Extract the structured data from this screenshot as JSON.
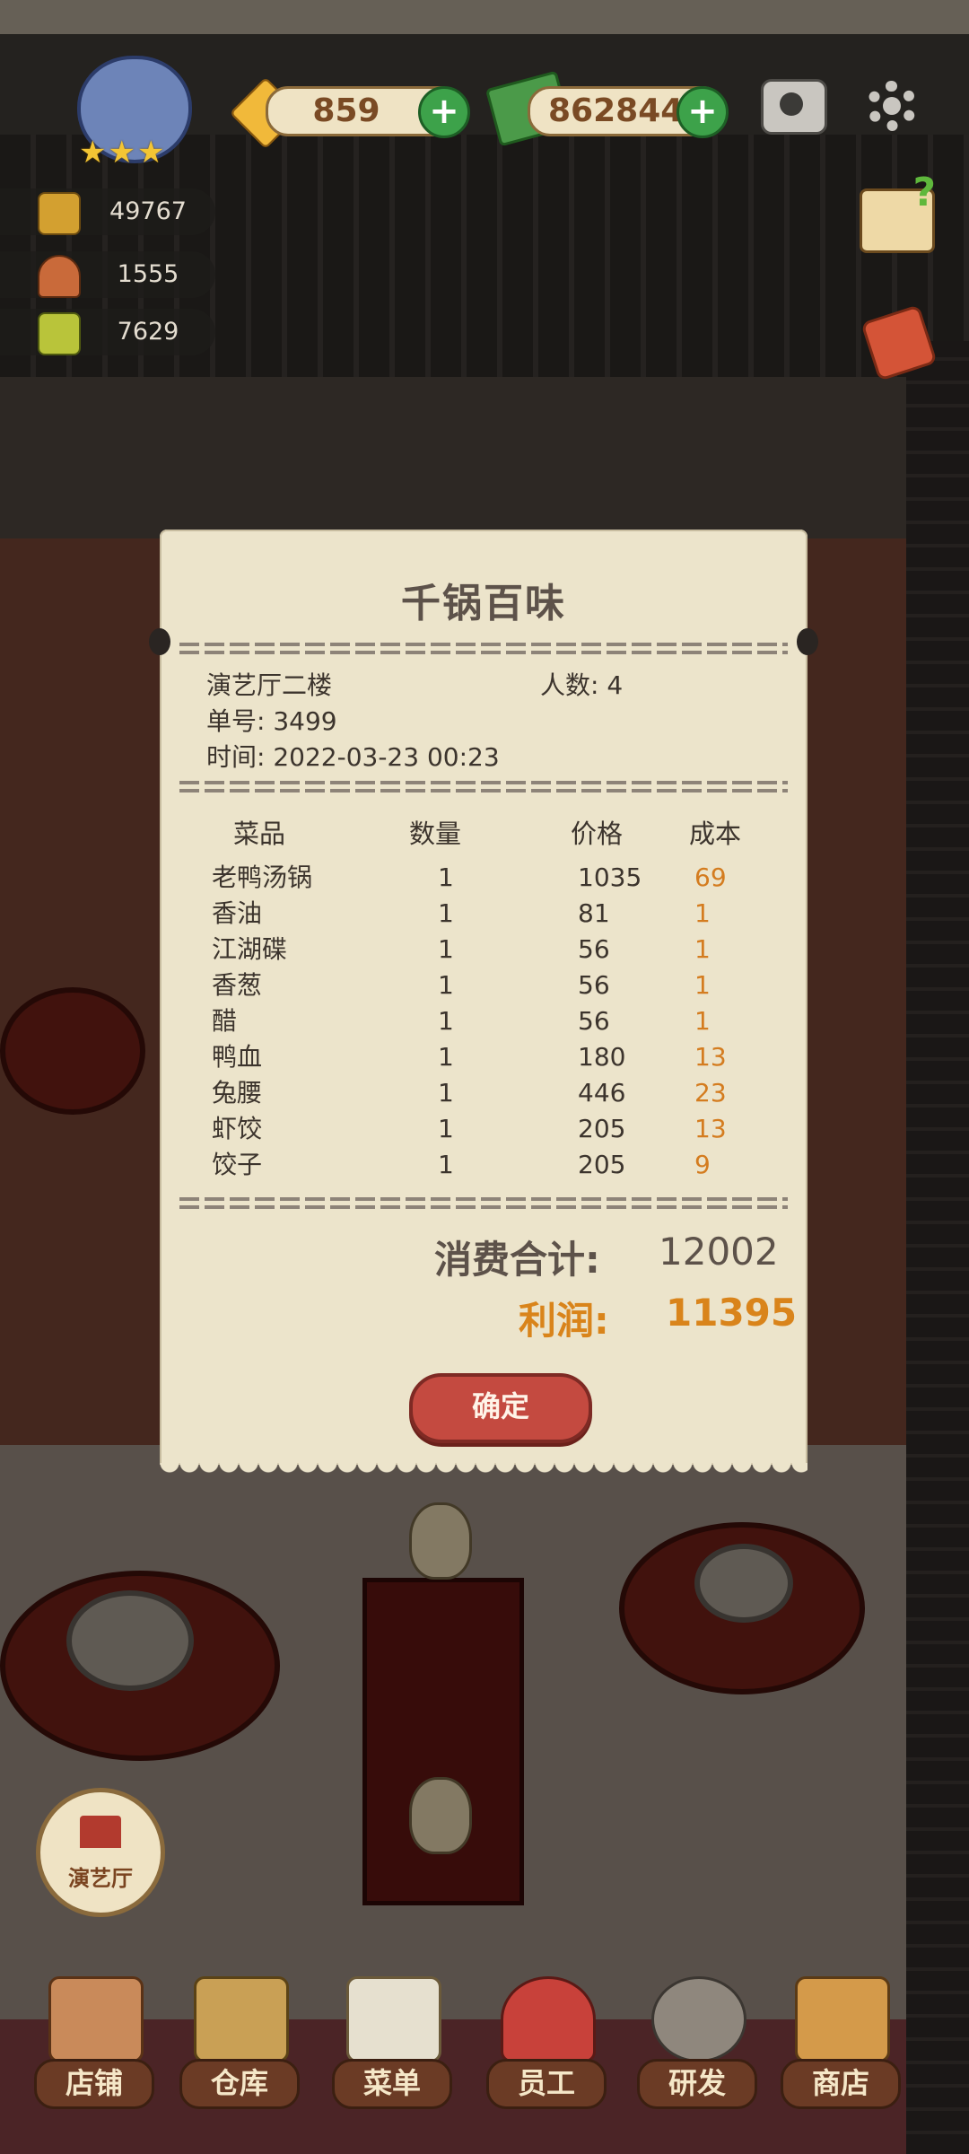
{
  "hud": {
    "gems": "859",
    "cash": "862844",
    "resources": [
      {
        "icon": "gold-pot-icon",
        "value": "49767"
      },
      {
        "icon": "bell-icon",
        "value": "1555"
      },
      {
        "icon": "ticket-icon",
        "value": "7629"
      }
    ]
  },
  "receipt": {
    "title": "千锅百味",
    "room_label": "演艺厅二楼",
    "guests_label": "人数: 4",
    "order_label": "单号: 3499",
    "time_label": "时间: 2022-03-23 00:23",
    "columns": [
      "菜品",
      "数量",
      "价格",
      "成本"
    ],
    "items": [
      {
        "name": "老鸭汤锅",
        "qty": "1",
        "price": "1035",
        "cost": "69"
      },
      {
        "name": "香油",
        "qty": "1",
        "price": "81",
        "cost": "1"
      },
      {
        "name": "江湖碟",
        "qty": "1",
        "price": "56",
        "cost": "1"
      },
      {
        "name": "香葱",
        "qty": "1",
        "price": "56",
        "cost": "1"
      },
      {
        "name": "醋",
        "qty": "1",
        "price": "56",
        "cost": "1"
      },
      {
        "name": "鸭血",
        "qty": "1",
        "price": "180",
        "cost": "13"
      },
      {
        "name": "兔腰",
        "qty": "1",
        "price": "446",
        "cost": "23"
      },
      {
        "name": "虾饺",
        "qty": "1",
        "price": "205",
        "cost": "13"
      },
      {
        "name": "饺子",
        "qty": "1",
        "price": "205",
        "cost": "9"
      }
    ],
    "total_label": "消费合计:",
    "total_value": "12002",
    "profit_label": "利润:",
    "profit_value": "11395",
    "confirm": "确定"
  },
  "venue_button": "演艺厅",
  "nav": [
    {
      "label": "店铺",
      "icon": "shop-building-icon"
    },
    {
      "label": "仓库",
      "icon": "warehouse-boxes-icon"
    },
    {
      "label": "菜单",
      "icon": "menu-clipboard-icon"
    },
    {
      "label": "员工",
      "icon": "staff-chef-icon"
    },
    {
      "label": "研发",
      "icon": "research-wok-icon"
    },
    {
      "label": "商店",
      "icon": "store-stall-icon"
    }
  ],
  "colors": {
    "cost": "#d47c1f",
    "profit": "#d9841b",
    "confirm": "#c44a40",
    "paper": "#ece4cb"
  }
}
